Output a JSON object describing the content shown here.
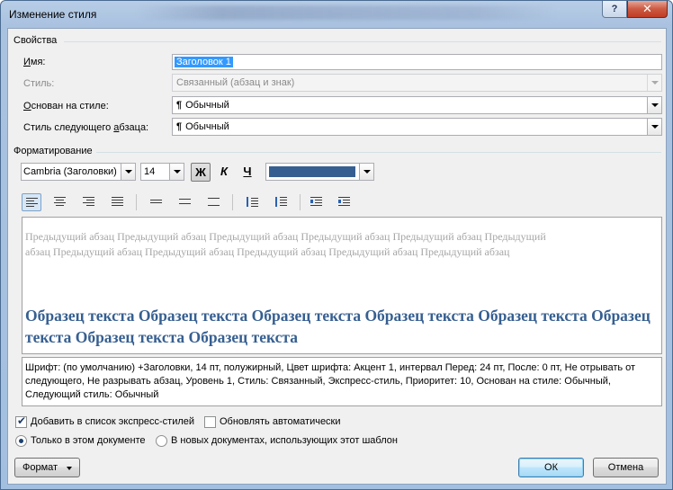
{
  "window": {
    "title": "Изменение стиля",
    "help_glyph": "?",
    "close_glyph": "✕"
  },
  "properties": {
    "section_title": "Свойства",
    "name_label": "Имя:",
    "name_value": "Заголовок 1",
    "style_type_label": "Стиль:",
    "style_type_value": "Связанный (абзац и знак)",
    "based_on_label": "Основан на стиле:",
    "based_on_value": "Обычный",
    "next_style_label": "Стиль следующего абзаца:",
    "next_style_value": "Обычный",
    "paragraph_mark": "¶"
  },
  "formatting": {
    "section_title": "Форматирование",
    "font_name": "Cambria (Заголовки)",
    "font_size": "14",
    "bold_glyph": "Ж",
    "italic_glyph": "К",
    "underline_glyph": "Ч",
    "font_color": "#365f91"
  },
  "toolbar_icons": [
    "align-left-icon",
    "align-center-icon",
    "align-right-icon",
    "justify-icon",
    "line-spacing-single-icon",
    "line-spacing-1-5-icon",
    "line-spacing-double-icon",
    "space-before-increase-icon",
    "space-before-decrease-icon",
    "indent-decrease-icon",
    "indent-increase-icon"
  ],
  "preview": {
    "previous_paragraph": "Предыдущий абзац Предыдущий абзац Предыдущий абзац Предыдущий абзац Предыдущий абзац Предыдущий абзац Предыдущий абзац Предыдущий абзац Предыдущий абзац Предыдущий абзац Предыдущий абзац",
    "sample_text": "Образец текста Образец текста Образец текста Образец текста Образец текста Образец текста Образец текста Образец текста"
  },
  "description": "Шрифт: (по умолчанию) +Заголовки, 14 пт, полужирный, Цвет шрифта: Акцент 1, интервал Перед:  24 пт, После:  0 пт, Не отрывать от следующего, Не разрывать абзац, Уровень 1, Стиль: Связанный, Экспресс-стиль, Приоритет: 10, Основан на стиле: Обычный, Следующий стиль: Обычный",
  "options": {
    "add_to_quick_styles": "Добавить в список экспресс-стилей",
    "add_to_quick_styles_checked": true,
    "auto_update": "Обновлять автоматически",
    "auto_update_checked": false,
    "only_this_document": "Только в этом документе",
    "new_documents_template": "В новых документах, использующих этот шаблон",
    "selected_scope": "only_this_document"
  },
  "buttons": {
    "format": "Формат",
    "ok": "ОК",
    "cancel": "Отмена"
  }
}
